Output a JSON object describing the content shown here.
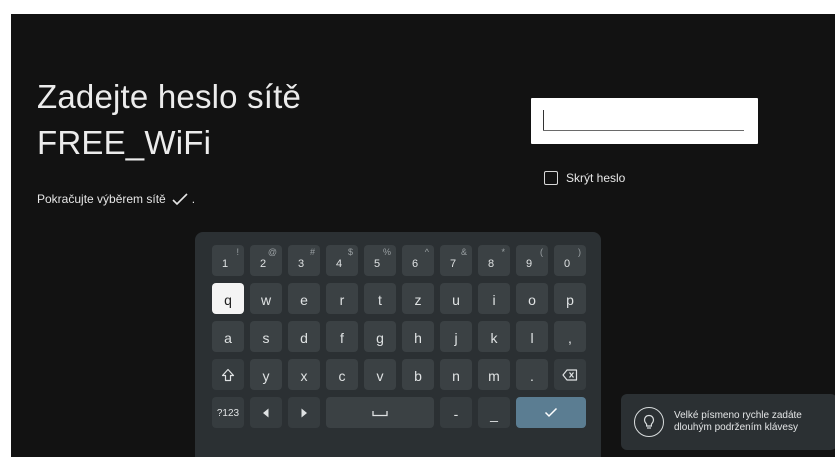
{
  "title": {
    "line1": "Zadejte heslo sítě",
    "line2": "FREE_WiFi"
  },
  "hint": {
    "text": "Pokračujte výběrem sítě",
    "suffix": "."
  },
  "password": {
    "value": ""
  },
  "hide_password": {
    "label": "Skrýt heslo",
    "checked": false
  },
  "keyboard": {
    "number_row": [
      {
        "main": "1",
        "alt": "!"
      },
      {
        "main": "2",
        "alt": "@"
      },
      {
        "main": "3",
        "alt": "#"
      },
      {
        "main": "4",
        "alt": "$"
      },
      {
        "main": "5",
        "alt": "%"
      },
      {
        "main": "6",
        "alt": "^"
      },
      {
        "main": "7",
        "alt": "&"
      },
      {
        "main": "8",
        "alt": "*"
      },
      {
        "main": "9",
        "alt": "("
      },
      {
        "main": "0",
        "alt": ")"
      }
    ],
    "row1": [
      "q",
      "w",
      "e",
      "r",
      "t",
      "z",
      "u",
      "i",
      "o",
      "p"
    ],
    "row2": [
      "a",
      "s",
      "d",
      "f",
      "g",
      "h",
      "j",
      "k",
      "l",
      ","
    ],
    "row3": [
      "y",
      "x",
      "c",
      "v",
      "b",
      "n",
      "m",
      "."
    ],
    "symbols_label": "?123",
    "focused_key": "q",
    "icons": {
      "shift": "shift-icon",
      "backspace": "backspace-icon",
      "left": "arrow-left-icon",
      "right": "arrow-right-icon",
      "space": "space-icon",
      "minus": "-",
      "underscore": "_",
      "enter": "check-icon"
    },
    "colors": {
      "background": "#2b3033",
      "key": "#3b4144",
      "focused": "#f4f4f4",
      "enter": "#5b7d92"
    }
  },
  "tip": {
    "line1": "Velké písmeno rychle zadáte",
    "line2": "dlouhým podržením klávesy",
    "icon": "lightbulb-icon"
  }
}
